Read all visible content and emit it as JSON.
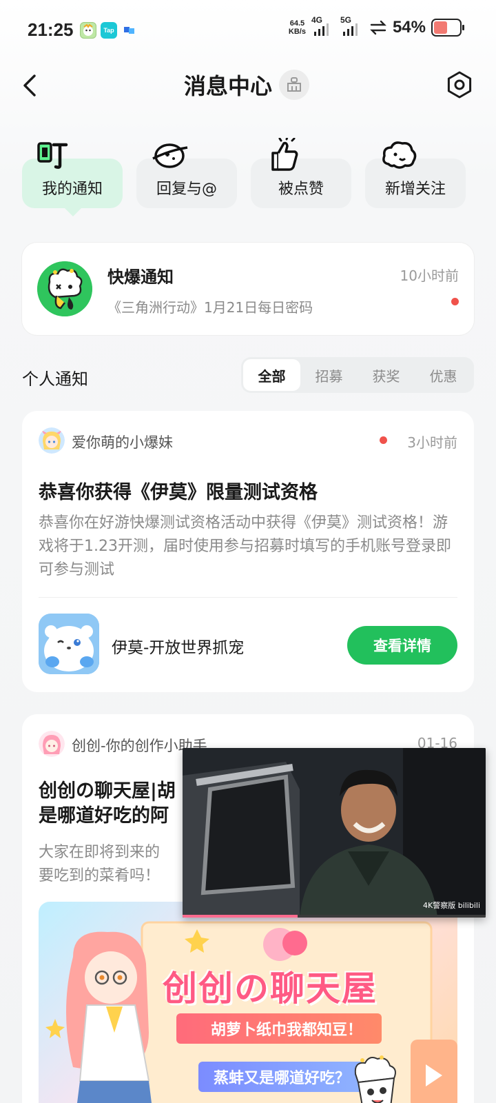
{
  "status_bar": {
    "time": "21:25",
    "net_speed_value": "64.5",
    "net_speed_unit": "KB/s",
    "signal1": "4G",
    "signal2": "5G",
    "battery_percent": "54%",
    "battery_level": 0.54,
    "app_icons": [
      "cartoon-app-icon",
      "taptap-icon",
      "blue-app-icon"
    ]
  },
  "header": {
    "title": "消息中心",
    "back_icon": "chevron-left-icon",
    "clean_icon": "broom-icon",
    "settings_icon": "gear-icon"
  },
  "categories": [
    {
      "label": "我的通知",
      "icon": "ding-icon",
      "active": true
    },
    {
      "label": "回复与@",
      "icon": "planet-chat-icon",
      "active": false
    },
    {
      "label": "被点赞",
      "icon": "thumbs-up-icon",
      "active": false
    },
    {
      "label": "新增关注",
      "icon": "follow-cloud-icon",
      "active": false
    }
  ],
  "kuaibao": {
    "title": "快爆通知",
    "subtitle": "《三角洲行动》1月21日每日密码",
    "time": "10小时前",
    "unread": true
  },
  "section": {
    "title": "个人通知",
    "filters": [
      {
        "label": "全部",
        "active": true
      },
      {
        "label": "招募",
        "active": false
      },
      {
        "label": "获奖",
        "active": false
      },
      {
        "label": "优惠",
        "active": false
      }
    ]
  },
  "notifications": [
    {
      "sender": "爱你萌的小爆妹",
      "time": "3小时前",
      "unread": true,
      "title": "恭喜你获得《伊莫》限量测试资格",
      "body": "恭喜你在好游快爆测试资格活动中获得《伊莫》测试资格！游戏将于1.23开测，届时使用参与招募时填写的手机账号登录即可参与测试",
      "game_name": "伊莫-开放世界抓宠",
      "button": "查看详情"
    },
    {
      "sender": "创创-你的创作小助手",
      "time": "01-16",
      "title_line1": "创创の聊天屋|胡",
      "title_line2": "是哪道好吃的阿",
      "body_line1": "大家在即将到来的",
      "body_line2": "要吃到的菜肴吗！",
      "banner_title": "创创の聊天屋",
      "banner_line1": "胡萝卜纸巾我都知豆！",
      "banner_line2": "蒸蚌又是哪道好吃？"
    }
  ],
  "video": {
    "watermark": "4K警察版 bilibili",
    "progress": 0.38
  },
  "colors": {
    "accent_green": "#22c05c",
    "active_tab_bg": "#d9f5e6",
    "unread_dot": "#f0524b",
    "battery_low": "#f27a72"
  }
}
